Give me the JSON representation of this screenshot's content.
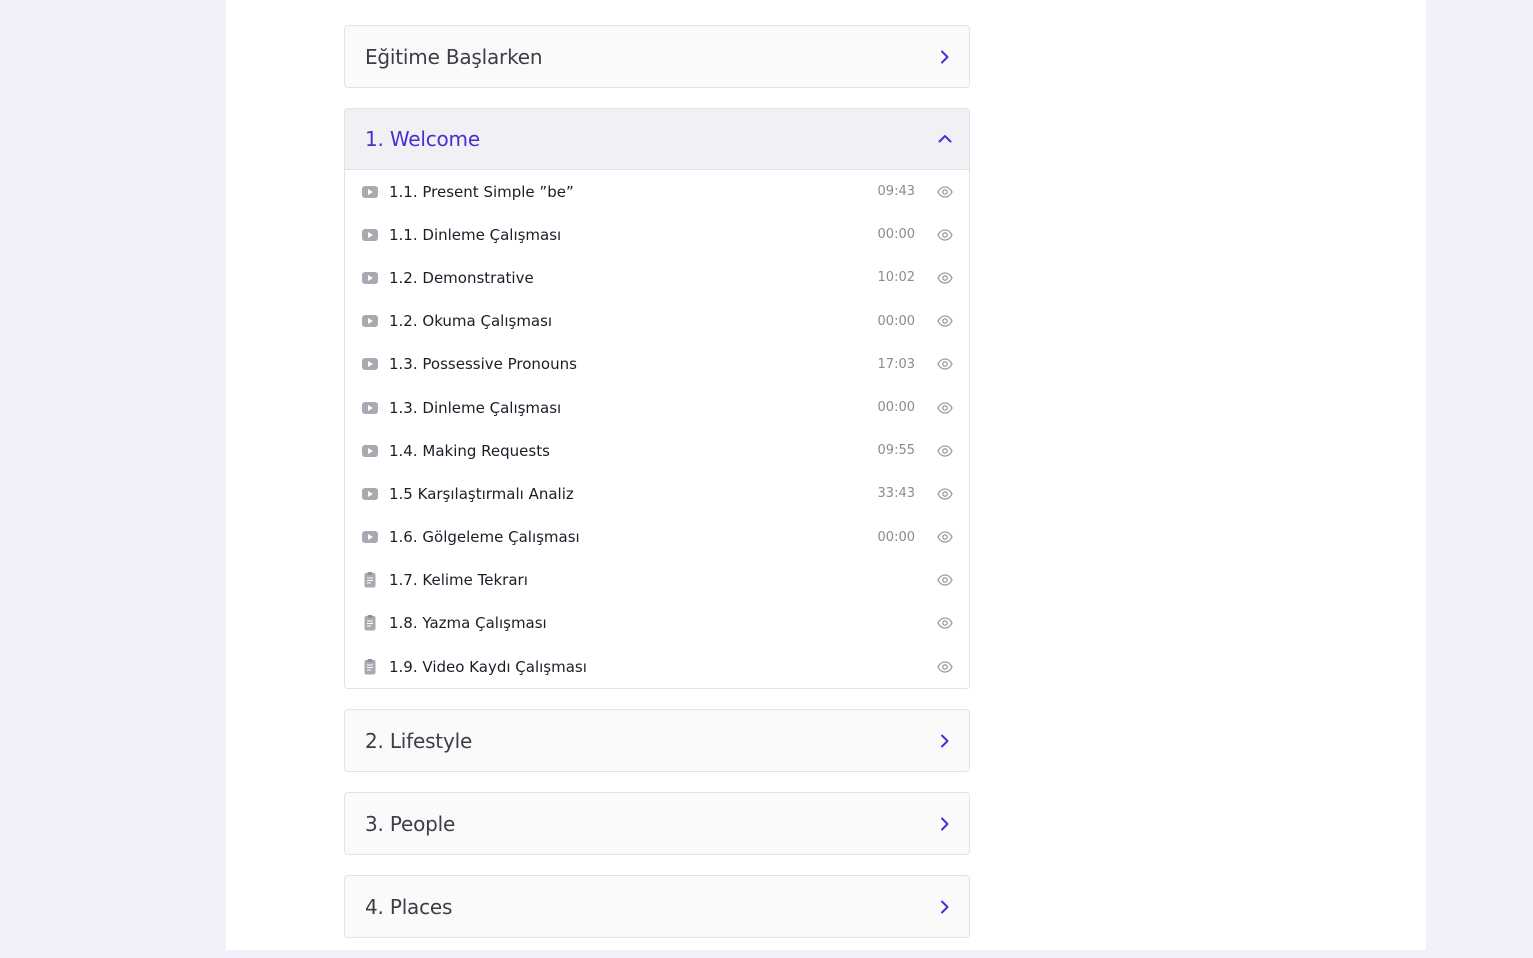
{
  "sections": [
    {
      "title": "Eğitime Başlarken",
      "expanded": false
    },
    {
      "title": "1. Welcome",
      "expanded": true,
      "lessons": [
        {
          "title": "1.1. Present Simple ”be”",
          "duration": "09:43",
          "icon": "video-icon"
        },
        {
          "title": "1.1. Dinleme Çalışması",
          "duration": "00:00",
          "icon": "video-icon"
        },
        {
          "title": "1.2. Demonstrative",
          "duration": "10:02",
          "icon": "video-icon"
        },
        {
          "title": "1.2. Okuma Çalışması",
          "duration": "00:00",
          "icon": "video-icon"
        },
        {
          "title": "1.3. Possessive Pronouns",
          "duration": "17:03",
          "icon": "video-icon"
        },
        {
          "title": "1.3. Dinleme Çalışması",
          "duration": "00:00",
          "icon": "video-icon"
        },
        {
          "title": "1.4. Making Requests",
          "duration": "09:55",
          "icon": "video-icon"
        },
        {
          "title": "1.5 Karşılaştırmalı Analiz",
          "duration": "33:43",
          "icon": "video-icon"
        },
        {
          "title": "1.6. Gölgeleme Çalışması",
          "duration": "00:00",
          "icon": "video-icon"
        },
        {
          "title": "1.7. Kelime Tekrarı",
          "duration": "",
          "icon": "document-icon"
        },
        {
          "title": "1.8. Yazma Çalışması",
          "duration": "",
          "icon": "document-icon"
        },
        {
          "title": "1.9. Video Kaydı Çalışması",
          "duration": "",
          "icon": "document-icon"
        }
      ]
    },
    {
      "title": "2. Lifestyle",
      "expanded": false
    },
    {
      "title": "3. People",
      "expanded": false
    },
    {
      "title": "4. Places",
      "expanded": false
    }
  ],
  "colors": {
    "accent": "#4a2fd0",
    "background": "#f1f0fb",
    "panel": "#ffffff",
    "icon_gray": "#a9a9b1"
  }
}
